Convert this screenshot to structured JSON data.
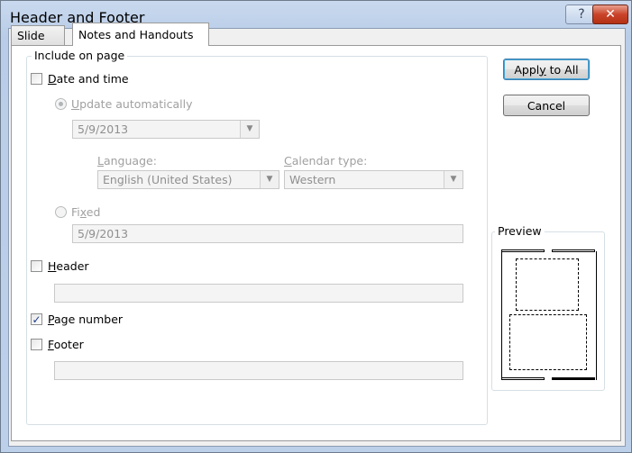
{
  "window": {
    "title": "Header and Footer",
    "help_glyph": "?",
    "close_glyph": "✕"
  },
  "tabs": [
    {
      "label": "Slide",
      "selected": false
    },
    {
      "label": "Notes and Handouts",
      "selected": true
    }
  ],
  "include_group": {
    "label": "Include on page",
    "date_and_time": {
      "label_accel": "D",
      "label_rest": "ate and time",
      "checked": false
    },
    "update_automatically": {
      "label_accel": "U",
      "label_rest": "pdate automatically",
      "selected": true,
      "date_value": "5/9/2013",
      "language": {
        "label_accel": "L",
        "label_rest": "anguage:",
        "value": "English (United States)"
      },
      "calendar_type": {
        "label_accel": "C",
        "label_rest": "alendar type:",
        "value": "Western"
      }
    },
    "fixed": {
      "label_pre": "Fi",
      "label_accel": "x",
      "label_rest": "ed",
      "selected": false,
      "value": "5/9/2013"
    },
    "header": {
      "label_accel": "H",
      "label_rest": "eader",
      "checked": false,
      "value": ""
    },
    "page_number": {
      "label_accel": "P",
      "label_rest": "age number",
      "checked": true,
      "check_glyph": "✓"
    },
    "footer": {
      "label_accel": "F",
      "label_rest": "ooter",
      "checked": false,
      "value": ""
    }
  },
  "buttons": {
    "apply_to_all": {
      "label_pre": "Appl",
      "label_accel": "y",
      "label_rest": " to All"
    },
    "cancel": {
      "label": "Cancel"
    }
  },
  "preview": {
    "label": "Preview"
  },
  "dropdown_glyph": "▼"
}
